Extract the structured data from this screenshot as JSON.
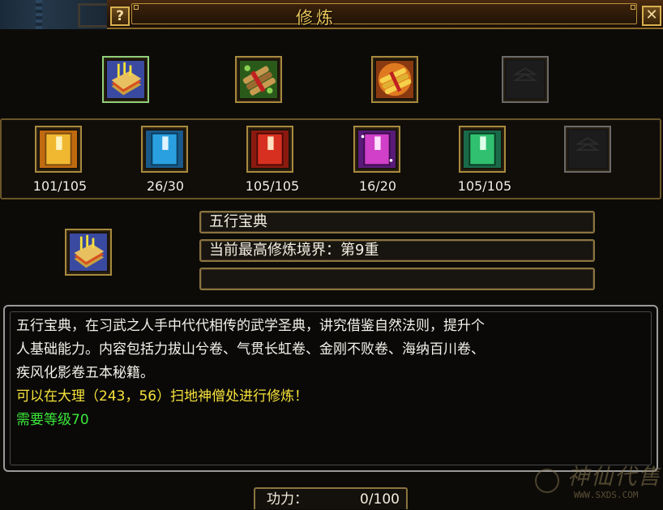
{
  "window": {
    "title": "修炼",
    "help_label": "?",
    "close_label": "✕"
  },
  "top_slots": [
    {
      "icon": "fire-book-icon",
      "selected": true
    },
    {
      "icon": "scroll-bundle-icon"
    },
    {
      "icon": "gold-scroll-icon"
    },
    {
      "icon": "empty-slot-icon"
    }
  ],
  "books": [
    {
      "icon": "yellow-book-icon",
      "count": "101/105",
      "color": "#e8a020"
    },
    {
      "icon": "blue-book-icon",
      "count": "26/30",
      "color": "#2aa0e0"
    },
    {
      "icon": "red-book-icon",
      "count": "105/105",
      "color": "#d83020"
    },
    {
      "icon": "purple-book-icon",
      "count": "16/20",
      "color": "#c030c0"
    },
    {
      "icon": "green-book-icon",
      "count": "105/105",
      "color": "#30c070"
    },
    {
      "icon": "empty-slot-icon",
      "count": ""
    }
  ],
  "selected": {
    "icon": "fire-book-icon",
    "name": "五行宝典",
    "realm": "当前最高修炼境界：第9重",
    "extra": ""
  },
  "description": {
    "line1": "五行宝典，在习武之人手中代代相传的武学圣典，讲究借鉴自然法则，提升个",
    "line2": "人基础能力。内容包括力拔山兮卷、气贯长虹卷、金刚不败卷、海纳百川卷、",
    "line3": "疾风化影卷五本秘籍。",
    "location_hint": "可以在大理（243，56）扫地神僧处进行修炼！",
    "level_req": "需要等级70"
  },
  "power": {
    "label": "功力：",
    "value": "0/100"
  },
  "watermark": {
    "text": "神仙代售",
    "url": "WWW.SXDS.COM"
  }
}
